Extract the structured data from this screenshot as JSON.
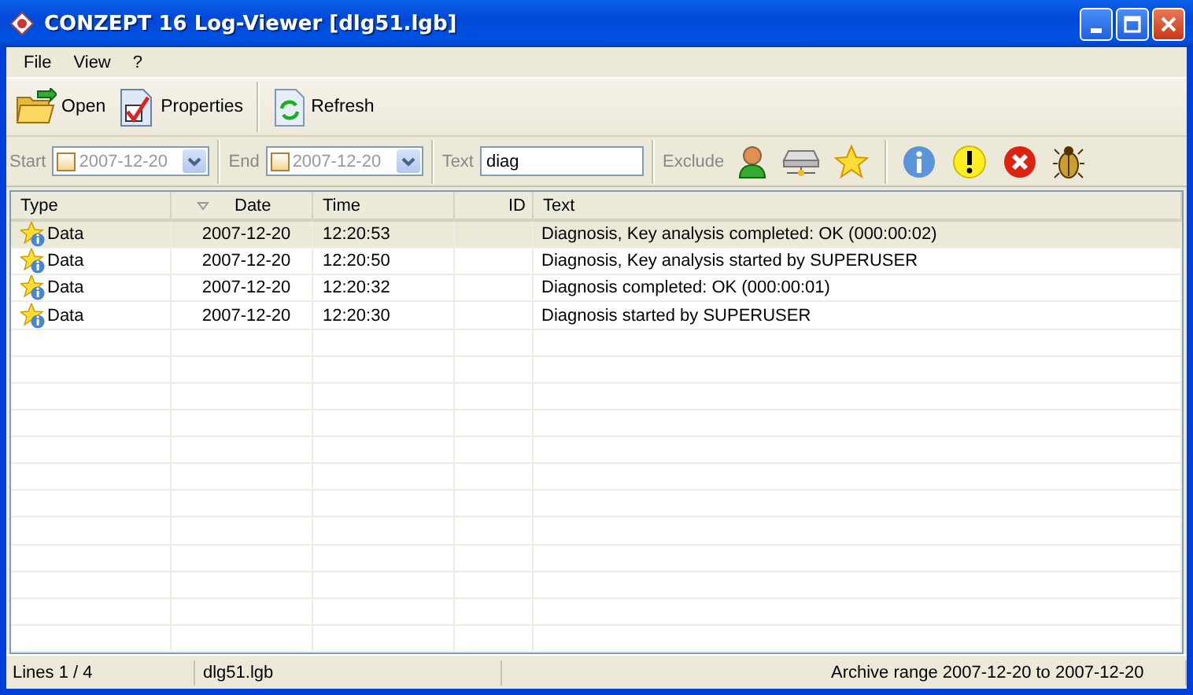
{
  "window": {
    "title": "CONZEPT 16 Log-Viewer [dlg51.lgb]"
  },
  "menu": [
    {
      "label": "File"
    },
    {
      "label": "View"
    },
    {
      "label": "?"
    }
  ],
  "toolbar": [
    {
      "label": "Open",
      "kind": "folder"
    },
    {
      "label": "Properties",
      "kind": "properties"
    },
    {
      "label": "Refresh",
      "kind": "refresh",
      "separator_before": true
    }
  ],
  "filter": {
    "start": {
      "label": "Start",
      "value": "2007-12-20",
      "checked": false,
      "disabled": true
    },
    "end": {
      "label": "End",
      "value": "2007-12-20",
      "checked": false,
      "disabled": true
    },
    "text": {
      "label": "Text",
      "value": "diag"
    },
    "exclude": {
      "label": "Exclude",
      "toggles": [
        {
          "kind": "user"
        },
        {
          "kind": "server"
        },
        {
          "kind": "star"
        }
      ],
      "levels": [
        {
          "kind": "info"
        },
        {
          "kind": "warning"
        },
        {
          "kind": "error"
        },
        {
          "kind": "debug"
        }
      ]
    }
  },
  "table": {
    "columns": [
      {
        "label": "Type",
        "sorted": false
      },
      {
        "label": "Date",
        "sorted": true
      },
      {
        "label": "Time",
        "sorted": false
      },
      {
        "label": "ID",
        "sorted": false
      },
      {
        "label": "Text",
        "sorted": false
      }
    ],
    "rows": [
      {
        "type": "Data",
        "date": "2007-12-20",
        "time": "12:20:53",
        "text": "Diagnosis, Key analysis completed: OK (000:00:02)",
        "selected": true
      },
      {
        "type": "Data",
        "date": "2007-12-20",
        "time": "12:20:50",
        "text": "Diagnosis, Key analysis started by SUPERUSER",
        "selected": false
      },
      {
        "type": "Data",
        "date": "2007-12-20",
        "time": "12:20:32",
        "text": "Diagnosis completed: OK (000:00:01)",
        "selected": false
      },
      {
        "type": "Data",
        "date": "2007-12-20",
        "time": "12:20:30",
        "text": "Diagnosis started by SUPERUSER",
        "selected": false
      }
    ]
  },
  "status_bar": [
    {
      "text": "Lines 1 / 4"
    },
    {
      "text": "dlg51.lgb"
    },
    {
      "text": "Archive range 2007-12-20 to 2007-12-20"
    }
  ]
}
